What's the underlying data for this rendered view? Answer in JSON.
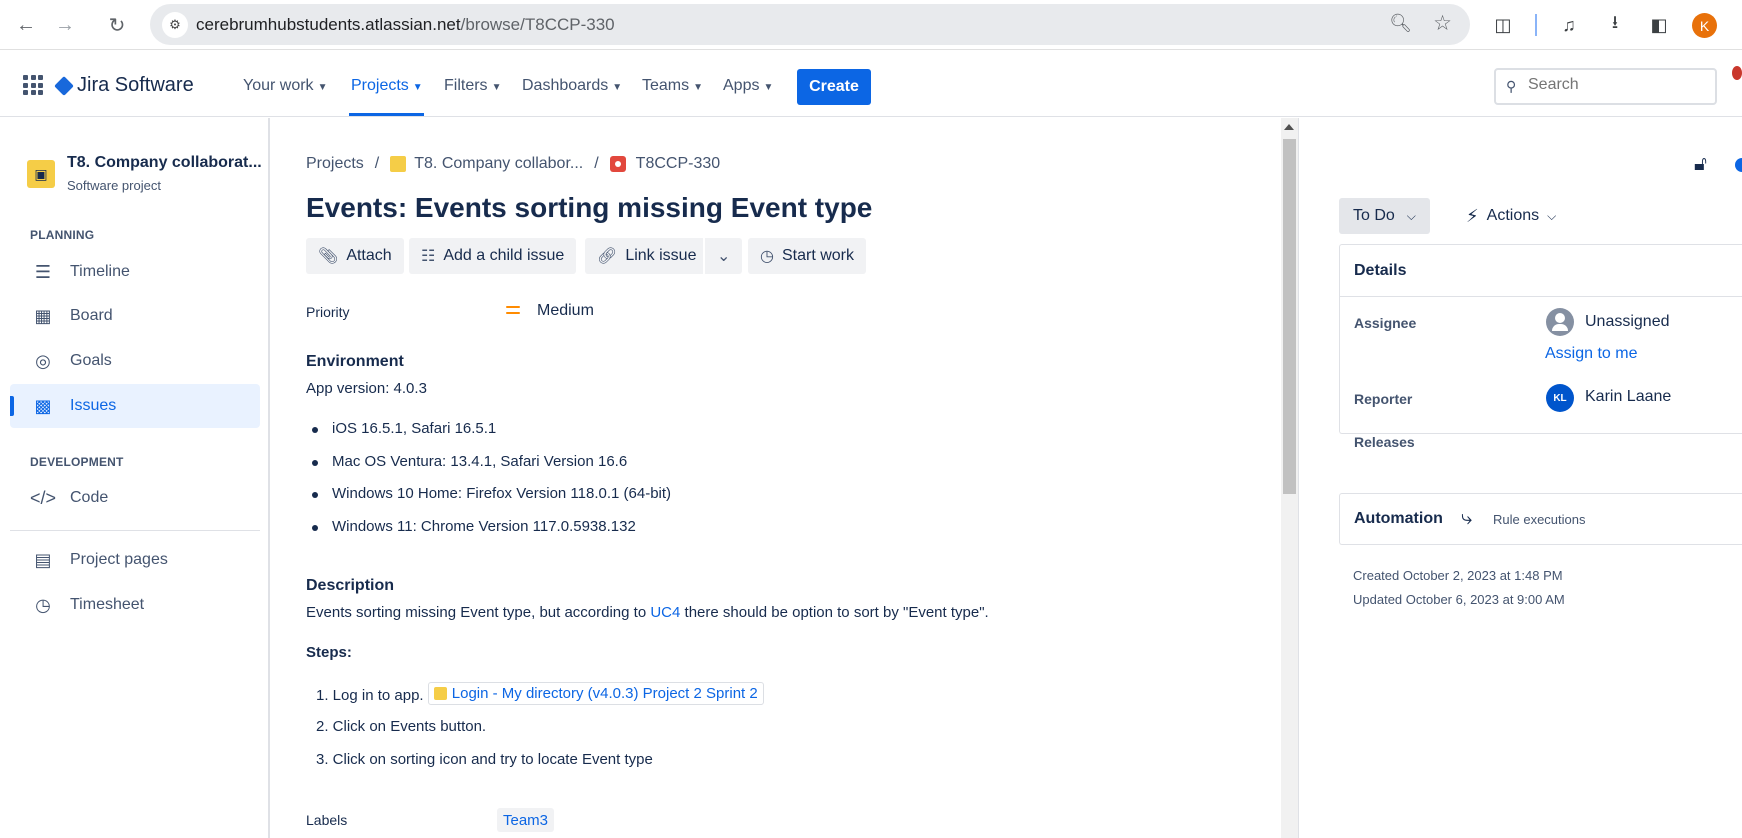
{
  "browser": {
    "url_host": "cerebrumhubstudents.atlassian.net",
    "url_path": "/browse/T8CCP-330",
    "profile_initial": "K"
  },
  "topnav": {
    "product": "Jira Software",
    "items": [
      {
        "label": "Your work"
      },
      {
        "label": "Projects"
      },
      {
        "label": "Filters"
      },
      {
        "label": "Dashboards"
      },
      {
        "label": "Teams"
      },
      {
        "label": "Apps"
      }
    ],
    "create_label": "Create",
    "search_placeholder": "Search"
  },
  "sidebar": {
    "project_name": "T8. Company collaborat...",
    "project_type": "Software project",
    "planning_label": "PLANNING",
    "development_label": "DEVELOPMENT",
    "items": {
      "timeline": "Timeline",
      "board": "Board",
      "goals": "Goals",
      "issues": "Issues",
      "code": "Code",
      "project_pages": "Project pages",
      "timesheet": "Timesheet"
    }
  },
  "issue": {
    "breadcrumbs": [
      "Projects",
      "T8. Company collabor...",
      "T8CCP-330"
    ],
    "title": "Events: Events sorting missing Event type",
    "actions": {
      "attach": "Attach",
      "add_child": "Add a child issue",
      "link_issue": "Link issue",
      "start_work": "Start work"
    },
    "priority_label": "Priority",
    "priority_value": "Medium",
    "environment_label": "Environment",
    "app_version": "App version: 4.0.3",
    "environments": [
      "iOS 16.5.1, Safari 16.5.1",
      "Mac OS Ventura: 13.4.1, Safari Version 16.6",
      "Windows 10 Home: Firefox Version 118.0.1 (64-bit)",
      "Windows 11: Chrome Version 117.0.5938.132"
    ],
    "description_label": "Description",
    "description": {
      "before": "Events sorting missing Event type, but according to ",
      "link": "UC4",
      "after": " there should be option to sort by \"Event type\"."
    },
    "steps_label": "Steps:",
    "steps": {
      "step1_prefix": "1. Log in to app.",
      "step1_link": "Login - My directory (v4.0.3) Project 2 Sprint 2",
      "step2": "2. Click on Events button.",
      "step3": "3. Click on sorting icon and try to locate Event type"
    },
    "labels_label": "Labels",
    "label_value": "Team3"
  },
  "panel": {
    "status": "To Do",
    "actions": "Actions",
    "details_label": "Details",
    "assignee_label": "Assignee",
    "assignee_value": "Unassigned",
    "assign_to_me": "Assign to me",
    "reporter_label": "Reporter",
    "reporter_initials": "KL",
    "reporter_value": "Karin Laane",
    "releases_label": "Releases",
    "automation_label": "Automation",
    "rule_executions": "Rule executions",
    "created": "Created October 2, 2023 at 1:48 PM",
    "updated": "Updated October 6, 2023 at 9:00 AM"
  }
}
